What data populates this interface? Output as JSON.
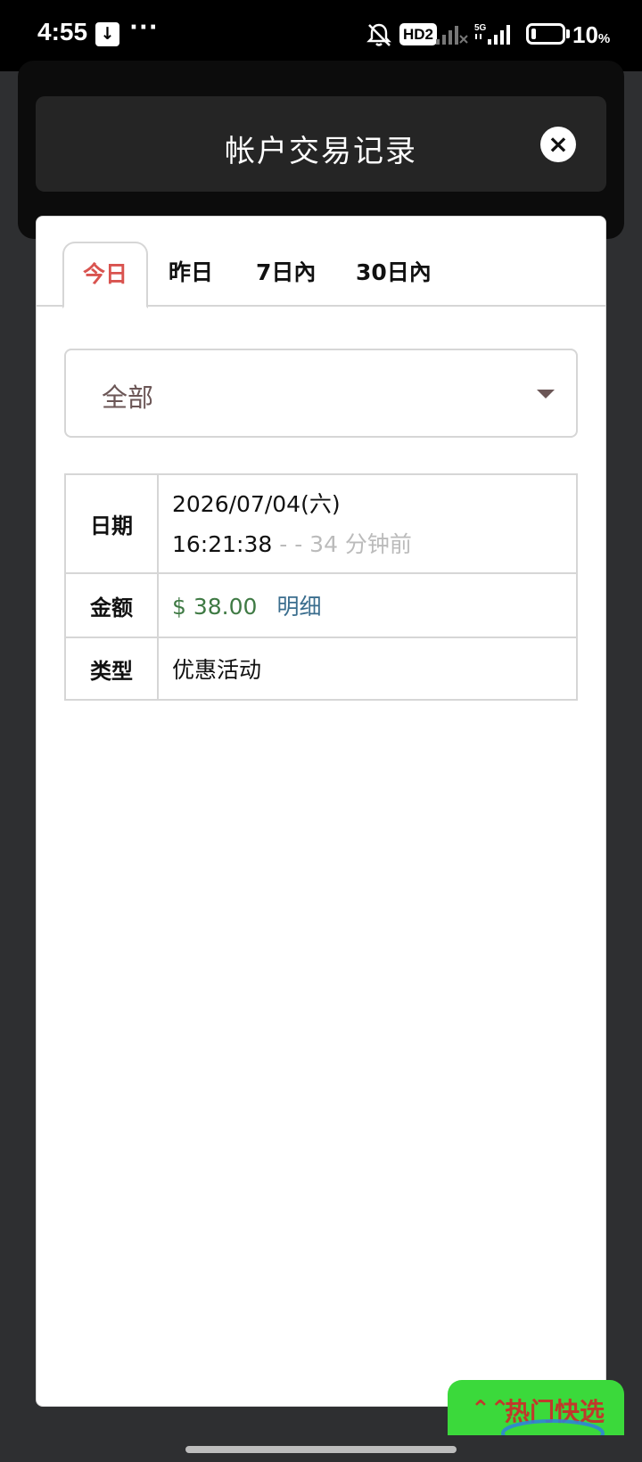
{
  "status_bar": {
    "time": "4:55",
    "download_glyph": "↓",
    "overflow": "···",
    "hd_badge": "HD2",
    "network": "5G",
    "battery_percent": "10",
    "battery_unit": "%",
    "battery_level": 0.1,
    "icons": [
      "download-icon",
      "bell-off-icon",
      "signal-icon",
      "battery-icon"
    ]
  },
  "modal": {
    "title": "帐户交易记录",
    "close_glyph": "×"
  },
  "tabs": [
    {
      "label": "今日",
      "active": true
    },
    {
      "label": "昨日",
      "active": false
    },
    {
      "label": "7日內",
      "active": false
    },
    {
      "label": "30日內",
      "active": false
    }
  ],
  "filter": {
    "selected": "全部"
  },
  "record": {
    "date_label": "日期",
    "date": "2026/07/04(六)",
    "time": "16:21:38",
    "ago": " -  - 34 分钟前",
    "amount_label": "金额",
    "amount": "$ 38.00",
    "detail_link": "明细",
    "type_label": "类型",
    "type": "优惠活动"
  },
  "quick_pick": {
    "label": "热门快选",
    "icon_glyph": "⌃⌃"
  },
  "colors": {
    "active_tab": "#d9534f",
    "amount": "#3f7a44",
    "link": "#3b6e8e",
    "quick_bg": "#3bd93b",
    "modal_header": "#252525",
    "backdrop": "#2e2f31"
  }
}
